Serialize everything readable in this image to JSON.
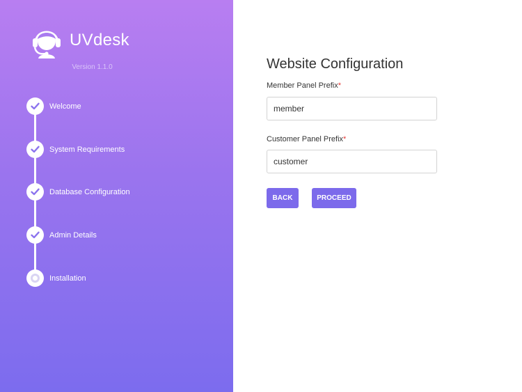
{
  "brand": {
    "name": "UVdesk",
    "version": "Version 1.1.0",
    "logo_icon": "support-agent-headset-icon"
  },
  "steps": [
    {
      "label": "Welcome",
      "status": "complete",
      "icon": "check-icon"
    },
    {
      "label": "System Requirements",
      "status": "complete",
      "icon": "check-icon"
    },
    {
      "label": "Database Configuration",
      "status": "complete",
      "icon": "check-icon"
    },
    {
      "label": "Admin Details",
      "status": "complete",
      "icon": "check-icon"
    },
    {
      "label": "Installation",
      "status": "pending",
      "icon": "pending-step-icon"
    }
  ],
  "form": {
    "title": "Website Configuration",
    "member_prefix": {
      "label": "Member Panel Prefix",
      "required_mark": "*",
      "value": "member"
    },
    "customer_prefix": {
      "label": "Customer Panel Prefix",
      "required_mark": "*",
      "value": "customer"
    },
    "back_label": "BACK",
    "proceed_label": "PROCEED"
  },
  "colors": {
    "sidebar_top": "#b87ef1",
    "sidebar_bottom": "#7c6cee",
    "accent": "#7c6aeb",
    "required": "#e53935"
  }
}
